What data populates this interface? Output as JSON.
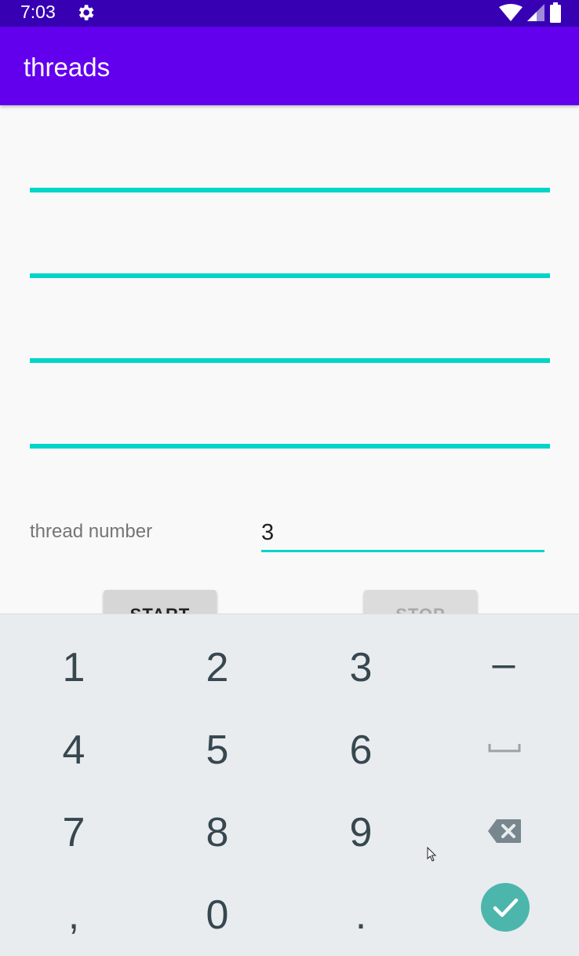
{
  "status_bar": {
    "time": "7:03",
    "bg_color": "#3700b3"
  },
  "app_bar": {
    "title": "threads",
    "bg_color": "#6200ee"
  },
  "progress_lines": {
    "count": 4,
    "color": "#00d5c8"
  },
  "form": {
    "thread_label": "thread number",
    "thread_value": "3"
  },
  "buttons": {
    "start_label": "START",
    "stop_label": "STOP"
  },
  "keyboard": {
    "keys": [
      "1",
      "2",
      "3",
      "–",
      "4",
      "5",
      "6",
      "space",
      "7",
      "8",
      "9",
      "backspace",
      ",",
      "0",
      ".",
      "done"
    ],
    "labels": {
      "k1": "1",
      "k2": "2",
      "k3": "3",
      "dash": "–",
      "k4": "4",
      "k5": "5",
      "k6": "6",
      "k7": "7",
      "k8": "8",
      "k9": "9",
      "comma": ",",
      "k0": "0",
      "period": "."
    },
    "accent_color": "#4db6ac"
  }
}
